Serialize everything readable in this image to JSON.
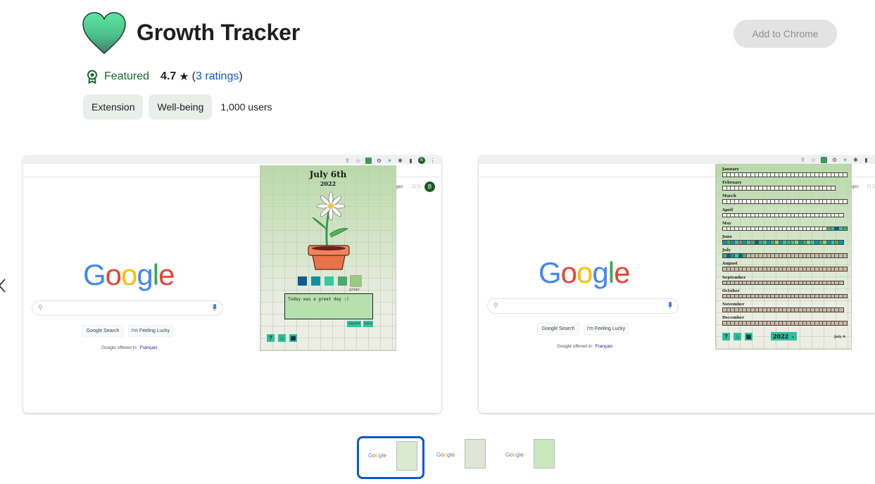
{
  "header": {
    "title": "Growth Tracker",
    "add_button": "Add to Chrome",
    "featured_label": "Featured",
    "rating_value": "4.7",
    "rating_star": "★",
    "ratings_link": "3 ratings",
    "paren_open": "(",
    "paren_close": ")",
    "chips": [
      "Extension",
      "Well-being"
    ],
    "users": "1,000 users"
  },
  "colors": {
    "accent_blue": "#0b57d0",
    "featured_green": "#146c2e",
    "popup_teal": "#2fbf9b",
    "moods": [
      "#0e5b96",
      "#10929e",
      "#36c7a3",
      "#4aa870",
      "#8fd17d"
    ]
  },
  "carousel": {
    "prev_icon": "chevron-left-icon",
    "screenshots": [
      {
        "google": {
          "logo_letters": [
            "G",
            "o",
            "o",
            "g",
            "l",
            "e"
          ],
          "search_button": "Google Search",
          "lucky_button": "I'm Feeling Lucky",
          "offered_in": "Google offered in:",
          "offered_lang": "Français",
          "avatar_letter": "B",
          "images_link": "ges"
        },
        "popup": {
          "date": "July 6th",
          "year": "2022",
          "mood_selected_label": "great",
          "journal_text": "Today was a great day :)",
          "expand_label": "expand",
          "save_label": "save",
          "nav_icons": [
            "?",
            "⌂",
            "▦"
          ]
        }
      },
      {
        "google": {
          "logo_letters": [
            "G",
            "o",
            "o",
            "g",
            "l",
            "e"
          ],
          "search_button": "Google Search",
          "lucky_button": "I'm Feeling Lucky",
          "offered_in": "Google offered in:",
          "offered_lang": "Français",
          "images_link": "ges"
        },
        "popup": {
          "months": [
            {
              "name": "January",
              "days": 31,
              "filled": []
            },
            {
              "name": "February",
              "days": 28,
              "filled": []
            },
            {
              "name": "March",
              "days": 31,
              "filled": []
            },
            {
              "name": "April",
              "days": 30,
              "filled": []
            },
            {
              "name": "May",
              "days": 31,
              "filled": [
                3,
                2,
                0,
                2,
                3
              ],
              "filled_start": 26
            },
            {
              "name": "June",
              "days": 30,
              "filled": [
                1,
                3,
                1,
                2,
                3,
                1,
                2,
                3,
                0,
                3,
                2,
                1,
                3,
                4,
                1,
                2,
                3,
                2,
                4,
                1,
                3,
                4,
                2,
                1,
                3,
                4,
                1,
                2,
                3,
                1
              ]
            },
            {
              "name": "July",
              "days": 31,
              "filled": [
                3,
                0,
                1,
                2,
                0,
                3
              ],
              "future_from": 6
            },
            {
              "name": "August",
              "days": 31,
              "future": true
            },
            {
              "name": "September",
              "days": 30,
              "future": true
            },
            {
              "name": "October",
              "days": 31,
              "future": true
            },
            {
              "name": "November",
              "days": 30,
              "future": true
            },
            {
              "name": "December",
              "days": 31,
              "future": true
            }
          ],
          "year_select": "2022",
          "year_chevron": "⌄",
          "today_label": "July 6",
          "nav_icons": [
            "?",
            "⌂",
            "▦"
          ]
        }
      }
    ],
    "thumbnails": [
      {
        "label": "Google",
        "selected": true
      },
      {
        "label": "Google",
        "selected": false
      },
      {
        "label": "Google",
        "selected": false
      }
    ]
  }
}
